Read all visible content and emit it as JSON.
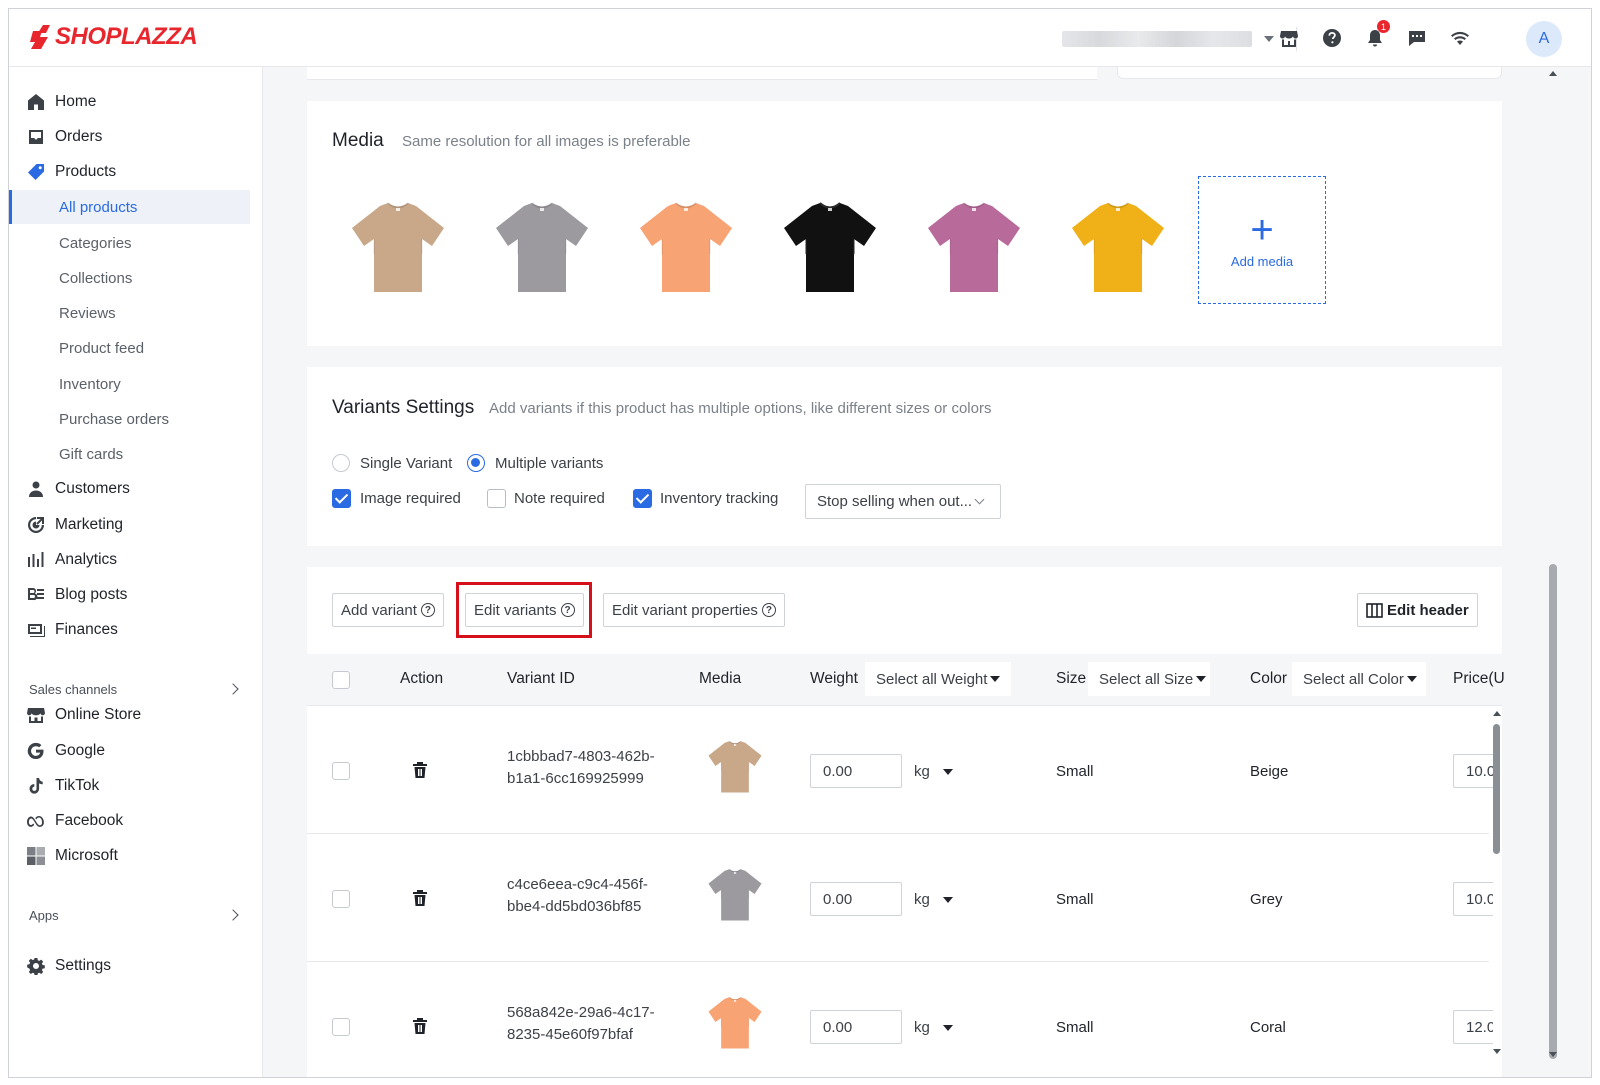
{
  "app": {
    "brand": "SHOPLAZZA",
    "brand_color": "#e8262d",
    "accent_color": "#2a6ae3"
  },
  "topbar": {
    "notifications_count": "1",
    "avatar_initial": "A",
    "icons": [
      "storefront-icon",
      "help-icon",
      "bell-icon",
      "chat-icon",
      "wifi-icon"
    ]
  },
  "sidebar": {
    "main_items": [
      {
        "label": "Home",
        "icon": "home-icon"
      },
      {
        "label": "Orders",
        "icon": "inbox-icon"
      },
      {
        "label": "Products",
        "icon": "tag-icon"
      }
    ],
    "product_sub_items": [
      {
        "label": "All products",
        "active": true
      },
      {
        "label": "Categories"
      },
      {
        "label": "Collections"
      },
      {
        "label": "Reviews"
      },
      {
        "label": "Product feed"
      },
      {
        "label": "Inventory"
      },
      {
        "label": "Purchase orders"
      },
      {
        "label": "Gift cards"
      }
    ],
    "more_items": [
      {
        "label": "Customers",
        "icon": "person-icon"
      },
      {
        "label": "Marketing",
        "icon": "target-icon"
      },
      {
        "label": "Analytics",
        "icon": "bar-chart-icon"
      },
      {
        "label": "Blog posts",
        "icon": "blog-icon"
      },
      {
        "label": "Finances",
        "icon": "finance-icon"
      }
    ],
    "sales_channels_label": "Sales channels",
    "channels": [
      {
        "label": "Online Store",
        "icon": "storefront-icon"
      },
      {
        "label": "Google",
        "icon": "google-icon"
      },
      {
        "label": "TikTok",
        "icon": "tiktok-icon"
      },
      {
        "label": "Facebook",
        "icon": "meta-icon"
      },
      {
        "label": "Microsoft",
        "icon": "microsoft-icon"
      }
    ],
    "apps_label": "Apps",
    "settings_label": "Settings"
  },
  "media": {
    "title": "Media",
    "subtitle": "Same resolution for all images is preferable",
    "add_media_label": "Add media",
    "plus": "+",
    "images": [
      {
        "name": "beige-tshirt",
        "color": "#c9a88a"
      },
      {
        "name": "grey-tshirt",
        "color": "#9c9a9f"
      },
      {
        "name": "coral-tshirt",
        "color": "#f7a373"
      },
      {
        "name": "black-tshirt",
        "color": "#111111"
      },
      {
        "name": "pink-tshirt",
        "color": "#b86a9a"
      },
      {
        "name": "yellow-tshirt",
        "color": "#efb117"
      }
    ]
  },
  "variants_settings": {
    "title": "Variants Settings",
    "subtitle": "Add variants if this product has multiple options, like different sizes or colors",
    "single_variant_label": "Single Variant",
    "multiple_variants_label": "Multiple variants",
    "multiple_selected": true,
    "image_required_label": "Image required",
    "image_required": true,
    "note_required_label": "Note required",
    "note_required": false,
    "inventory_tracking_label": "Inventory tracking",
    "inventory_tracking": true,
    "out_of_stock_policy": "Stop selling when out..."
  },
  "variants_table": {
    "toolbar": {
      "add_variant": "Add variant",
      "edit_variants": "Edit variants",
      "edit_variant_properties": "Edit variant properties",
      "edit_header": "Edit header",
      "help": "?"
    },
    "headers": {
      "action": "Action",
      "variant_id": "Variant ID",
      "media": "Media",
      "weight": "Weight",
      "weight_select": "Select all Weight",
      "size": "Size",
      "size_select": "Select all Size",
      "color": "Color",
      "color_select": "Select all Color",
      "price": "Price(U"
    },
    "rows": [
      {
        "id_line1": "1cbbbad7-4803-462b-",
        "id_line2": "b1a1-6cc169925999",
        "weight": "0.00",
        "unit": "kg",
        "size": "Small",
        "color": "Beige",
        "price": "10.0",
        "swatch": "#c9a88a"
      },
      {
        "id_line1": "c4ce6eea-c9c4-456f-",
        "id_line2": "bbe4-dd5bd036bf85",
        "weight": "0.00",
        "unit": "kg",
        "size": "Small",
        "color": "Grey",
        "price": "10.0",
        "swatch": "#9c9a9f"
      },
      {
        "id_line1": "568a842e-29a6-4c17-",
        "id_line2": "8235-45e60f97bfaf",
        "weight": "0.00",
        "unit": "kg",
        "size": "Small",
        "color": "Coral",
        "price": "12.0",
        "swatch": "#f7a373"
      }
    ]
  }
}
